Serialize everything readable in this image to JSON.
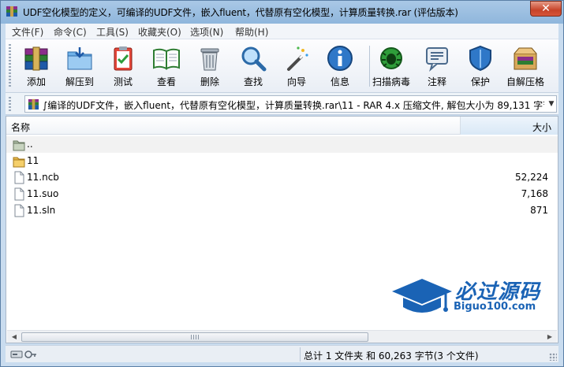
{
  "window": {
    "title": "UDF空化模型的定义，可编译的UDF文件，嵌入fluent，代替原有空化模型，计算质量转换.rar (评估版本)",
    "close_label": "✕"
  },
  "menu": [
    {
      "label": "文件(F)"
    },
    {
      "label": "命令(C)"
    },
    {
      "label": "工具(S)"
    },
    {
      "label": "收藏夹(O)"
    },
    {
      "label": "选项(N)"
    },
    {
      "label": "帮助(H)"
    }
  ],
  "toolbar": [
    {
      "label": "添加",
      "icon": "add-archive-icon"
    },
    {
      "label": "解压到",
      "icon": "extract-folder-icon"
    },
    {
      "label": "测试",
      "icon": "test-clipboard-icon"
    },
    {
      "label": "查看",
      "icon": "view-book-icon"
    },
    {
      "label": "删除",
      "icon": "trash-icon"
    },
    {
      "label": "查找",
      "icon": "magnifier-icon"
    },
    {
      "label": "向导",
      "icon": "wizard-wand-icon"
    },
    {
      "label": "信息",
      "icon": "info-icon"
    },
    {
      "label": "扫描病毒",
      "icon": "virus-scan-icon"
    },
    {
      "label": "注释",
      "icon": "comment-icon"
    },
    {
      "label": "保护",
      "icon": "shield-icon"
    },
    {
      "label": "自解压格",
      "icon": "sfx-box-icon"
    }
  ],
  "address": {
    "path": "∫编译的UDF文件，嵌入fluent，代替原有空化模型，计算质量转换.rar\\11 - RAR 4.x 压缩文件, 解包大小为 89,131 字节"
  },
  "columns": {
    "name": "名称",
    "size": "大小"
  },
  "files": [
    {
      "name": "..",
      "size": "",
      "type": "parent"
    },
    {
      "name": "11",
      "size": "",
      "type": "folder"
    },
    {
      "name": "11.ncb",
      "size": "52,224",
      "type": "file"
    },
    {
      "name": "11.suo",
      "size": "7,168",
      "type": "file"
    },
    {
      "name": "11.sln",
      "size": "871",
      "type": "file"
    }
  ],
  "watermark": {
    "brand": "必过源码",
    "url": "Biguo100.com"
  },
  "status": {
    "summary": "总计 1 文件夹 和 60,263 字节(3 个文件)"
  },
  "colors": {
    "accent": "#1a63b5",
    "titlebar": "#8fb6dc",
    "close": "#c74329"
  }
}
